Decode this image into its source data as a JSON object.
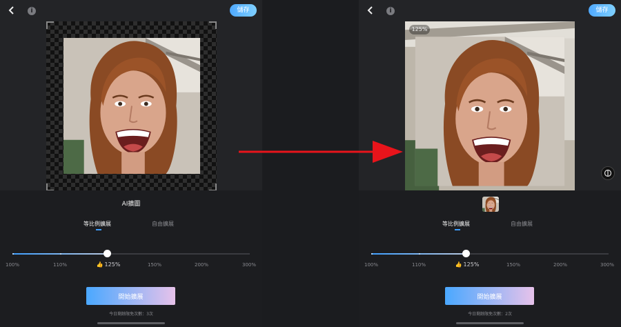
{
  "left_panel": {
    "save_label": "儲存",
    "info_glyph": "i",
    "title": "AI擴圖",
    "tabs": [
      {
        "label": "等比例擴展",
        "active": true
      },
      {
        "label": "自由擴展",
        "active": false
      }
    ],
    "slider": {
      "value_percent": 125,
      "ticks": [
        "100%",
        "110%",
        "125%",
        "150%",
        "200%",
        "300%"
      ],
      "selected_tick": "125%"
    },
    "start_label": "開始擴展",
    "quota_text": "今日剩餘限免次數：3次"
  },
  "right_panel": {
    "save_label": "儲存",
    "info_glyph": "i",
    "zoom_badge": "125%",
    "tabs": [
      {
        "label": "等比例擴展",
        "active": true
      },
      {
        "label": "自由擴展",
        "active": false
      }
    ],
    "slider": {
      "value_percent": 125,
      "ticks": [
        "100%",
        "110%",
        "125%",
        "150%",
        "200%",
        "300%"
      ],
      "selected_tick": "125%"
    },
    "start_label": "開始擴展",
    "quota_text": "今日剩餘限免次數：2次"
  },
  "icons": {
    "back": "back-icon",
    "info": "info-icon",
    "compare": "compare-icon",
    "thumbs_up": "👍"
  },
  "colors": {
    "accent_blue": "#3e9fff",
    "background": "#1b1c1f",
    "annotation_arrow": "#e8141b"
  }
}
